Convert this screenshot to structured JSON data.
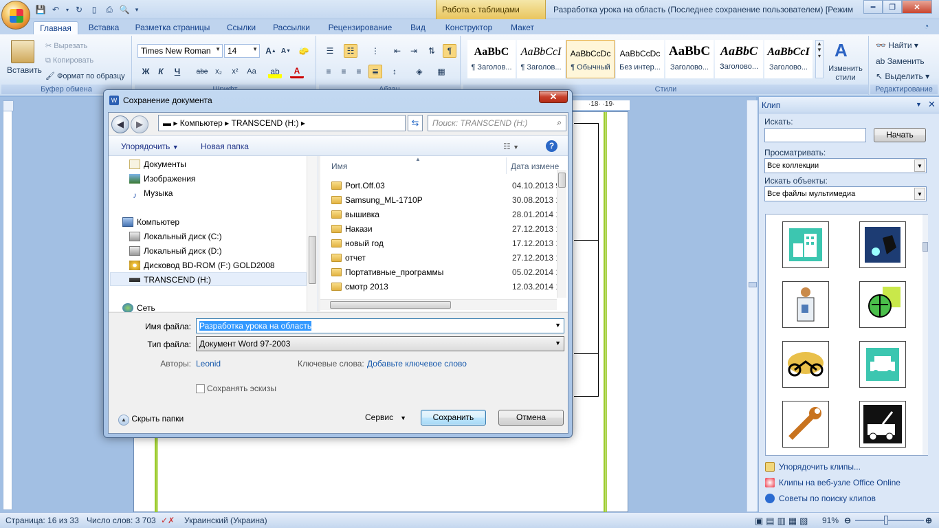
{
  "titlebar": {
    "context_tab": "Работа с таблицами",
    "title": "Разработка урока на область (Последнее сохранение пользователем) [Режим ограниченной функциональности] - Microsoft Word"
  },
  "tabs": [
    "Главная",
    "Вставка",
    "Разметка страницы",
    "Ссылки",
    "Рассылки",
    "Рецензирование",
    "Вид",
    "Конструктор",
    "Макет"
  ],
  "ribbon": {
    "clipboard": {
      "paste": "Вставить",
      "cut": "Вырезать",
      "copy": "Копировать",
      "format_painter": "Формат по образцу",
      "label": "Буфер обмена"
    },
    "font": {
      "name": "Times New Roman",
      "size": "14",
      "label": "Шрифт",
      "bold": "Ж",
      "italic": "К",
      "underline": "Ч",
      "strike": "abe",
      "sub": "x₂",
      "sup": "x²",
      "case": "Aa"
    },
    "paragraph": {
      "label": "Абзац"
    },
    "styles": {
      "items": [
        {
          "sample": "AaBbC",
          "name": "¶ Заголов..."
        },
        {
          "sample": "AaBbCcI",
          "name": "¶ Заголов..."
        },
        {
          "sample": "AaBbCcDc",
          "name": "¶ Обычный"
        },
        {
          "sample": "AaBbCcDc",
          "name": "Без интер..."
        },
        {
          "sample": "AaBbC",
          "name": "Заголово..."
        },
        {
          "sample": "AaBbC",
          "name": "Заголово..."
        },
        {
          "sample": "AaBbCcI",
          "name": "Заголово..."
        }
      ],
      "change": "Изменить стили",
      "label": "Стили"
    },
    "editing": {
      "find": "Найти",
      "replace": "Заменить",
      "select": "Выделить",
      "label": "Редактирование"
    }
  },
  "ruler": {
    "marks": "·18·  ·19·"
  },
  "clip": {
    "title": "Клип",
    "search_label": "Искать:",
    "search_value": "",
    "go": "Начать",
    "browse_label": "Просматривать:",
    "browse_value": "Все коллекции",
    "types_label": "Искать объекты:",
    "types_value": "Все файлы мультимедиа",
    "link_organize": "Упорядочить клипы...",
    "link_online": "Клипы на веб-узле Office Online",
    "link_tips": "Советы по поиску клипов"
  },
  "status": {
    "page": "Страница: 16 из 33",
    "words": "Число слов: 3 703",
    "lang": "Украинский (Украина)",
    "zoom": "91%"
  },
  "dialog": {
    "title": "Сохранение документа",
    "breadcrumb": [
      "Компьютер",
      "TRANSCEND (H:)"
    ],
    "search_placeholder": "Поиск: TRANSCEND (H:)",
    "organize": "Упорядочить",
    "new_folder": "Новая папка",
    "nav": [
      {
        "label": "Документы",
        "icon": "documents-icon"
      },
      {
        "label": "Изображения",
        "icon": "pictures-icon"
      },
      {
        "label": "Музыка",
        "icon": "music-icon"
      },
      {
        "label": "Компьютер",
        "icon": "computer-icon"
      },
      {
        "label": "Локальный диск (C:)",
        "icon": "drive-icon"
      },
      {
        "label": "Локальный диск (D:)",
        "icon": "drive-icon"
      },
      {
        "label": "Дисковод BD-ROM (F:) GOLD2008",
        "icon": "disc-icon"
      },
      {
        "label": "TRANSCEND (H:)",
        "icon": "usb-drive-icon"
      },
      {
        "label": "Сеть",
        "icon": "network-icon"
      }
    ],
    "col_name": "Имя",
    "col_date": "Дата измене",
    "files": [
      {
        "name": "Port.Off.03",
        "date": "04.10.2013 9:"
      },
      {
        "name": "Samsung_ML-1710P",
        "date": "30.08.2013 1!"
      },
      {
        "name": "вышивка",
        "date": "28.01.2014 1:"
      },
      {
        "name": "Накази",
        "date": "27.12.2013 1:"
      },
      {
        "name": "новый год",
        "date": "17.12.2013 1("
      },
      {
        "name": "отчет",
        "date": "27.12.2013 1:"
      },
      {
        "name": "Портативные_программы",
        "date": "05.02.2014 1:"
      },
      {
        "name": "смотр 2013",
        "date": "12.03.2014 1:"
      }
    ],
    "filename_label": "Имя файла:",
    "filename": "Разработка урока на область",
    "filetype_label": "Тип файла:",
    "filetype": "Документ Word 97-2003",
    "authors_label": "Авторы:",
    "authors": "Leonid",
    "keywords_label": "Ключевые слова:",
    "keywords": "Добавьте ключевое слово",
    "thumbs": "Сохранять эскизы",
    "hide_folders": "Скрыть папки",
    "service": "Сервис",
    "save": "Сохранить",
    "cancel": "Отмена"
  }
}
